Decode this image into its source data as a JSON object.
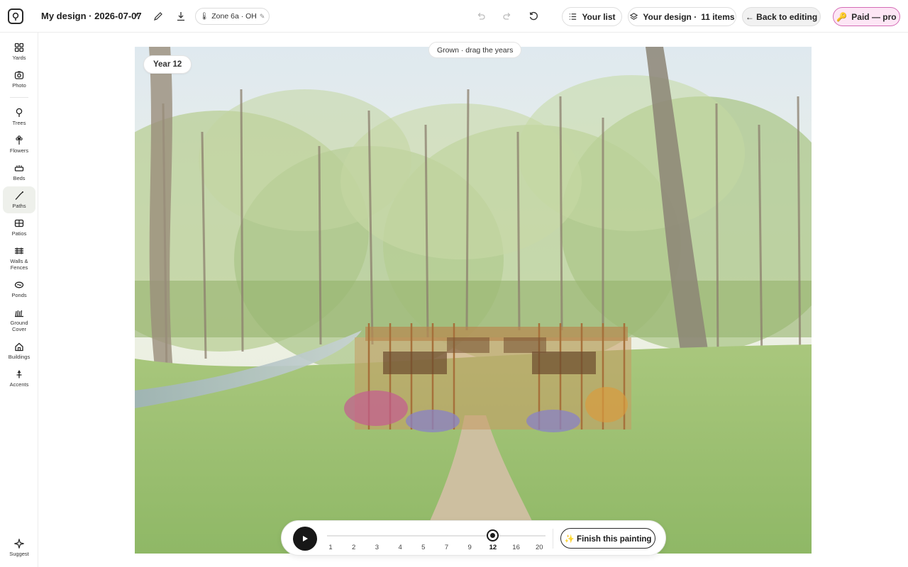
{
  "header": {
    "design_title": "My design · 2026-07-07",
    "zone_label": "Zone 6a · OH",
    "your_list_label": "Your list",
    "your_design_label": "Your design ·",
    "your_design_count": "11 items",
    "back_label": "← Back to editing",
    "paid_label": "Paid — pro"
  },
  "sidebar": {
    "items": [
      {
        "label": "Yards",
        "icon": "grid-icon"
      },
      {
        "label": "Photo",
        "icon": "camera-icon"
      },
      {
        "label": "Trees",
        "icon": "tree-icon"
      },
      {
        "label": "Flowers",
        "icon": "flower-icon"
      },
      {
        "label": "Beds",
        "icon": "bed-icon"
      },
      {
        "label": "Paths",
        "icon": "path-icon"
      },
      {
        "label": "Patios",
        "icon": "patio-icon"
      },
      {
        "label": "Walls & Fences",
        "icon": "fence-icon"
      },
      {
        "label": "Ponds",
        "icon": "pond-icon"
      },
      {
        "label": "Ground Cover",
        "icon": "ground-cover-icon"
      },
      {
        "label": "Buildings",
        "icon": "building-icon"
      },
      {
        "label": "Accents",
        "icon": "accent-icon"
      }
    ],
    "suggest_label": "Suggest",
    "active_item": "Paths"
  },
  "canvas": {
    "year_label": "Year 12",
    "grown_label": "Grown · drag the years",
    "image_description_icon": "watercolor-garden-painting"
  },
  "timeline": {
    "years": [
      "1",
      "2",
      "3",
      "4",
      "5",
      "7",
      "9",
      "12",
      "16",
      "20"
    ],
    "current_year": "12",
    "finish_label": "✨ Finish this painting"
  },
  "colors": {
    "accent_pink": "#d46cb6",
    "paid_bg": "#fde6f5",
    "play_bg": "#171717"
  }
}
